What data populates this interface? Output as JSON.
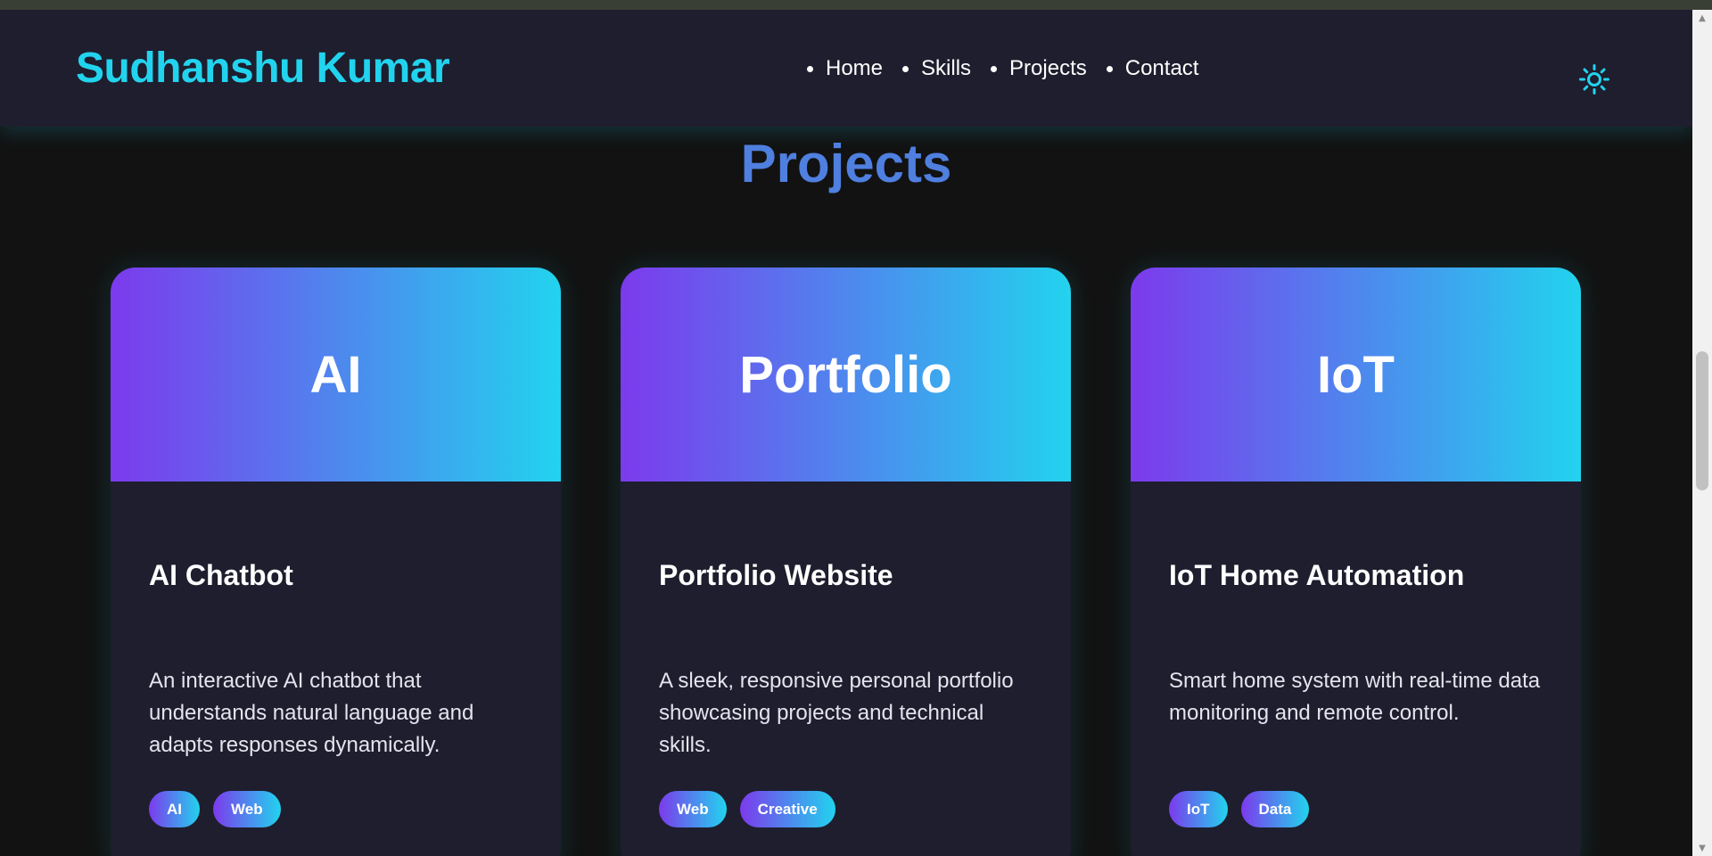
{
  "header": {
    "brand": "Sudhanshu Kumar",
    "nav": [
      "Home",
      "Skills",
      "Projects",
      "Contact"
    ],
    "theme_toggle_icon": "sun-icon"
  },
  "section": {
    "title": "Projects"
  },
  "projects": [
    {
      "banner": "AI",
      "title": "AI Chatbot",
      "description": "An interactive AI chatbot that understands natural language and adapts responses dynamically.",
      "tags": [
        "AI",
        "Web"
      ]
    },
    {
      "banner": "Portfolio",
      "title": "Portfolio Website",
      "description": "A sleek, responsive personal portfolio showcasing projects and technical skills.",
      "tags": [
        "Web",
        "Creative"
      ]
    },
    {
      "banner": "IoT",
      "title": "IoT Home Automation",
      "description": "Smart home system with real-time data monitoring and remote control.",
      "tags": [
        "IoT",
        "Data"
      ]
    }
  ],
  "colors": {
    "accent": "#22d3ee",
    "purple": "#7c3aed",
    "title_blue": "#4f7fdf",
    "card_bg": "#1e1e2e",
    "page_bg": "#121212"
  }
}
